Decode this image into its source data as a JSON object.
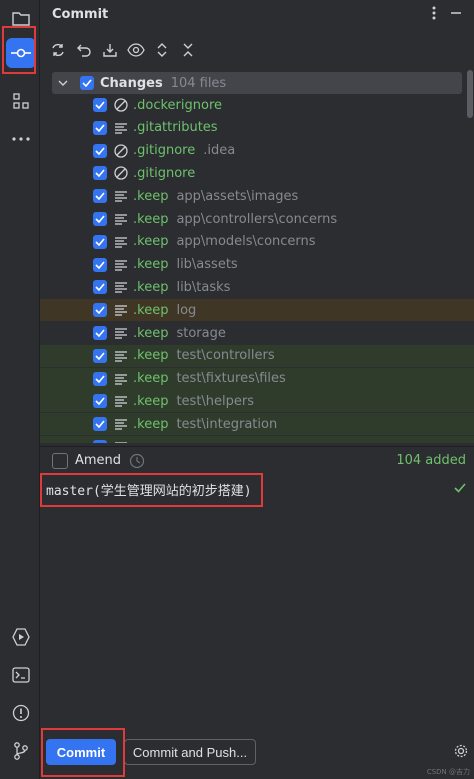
{
  "panel": {
    "title": "Commit"
  },
  "changes": {
    "label": "Changes",
    "count_text": "104 files"
  },
  "files": [
    {
      "name": ".dockerignore",
      "path": "",
      "icon": "ignore-icon",
      "hl": ""
    },
    {
      "name": ".gitattributes",
      "path": "",
      "icon": "text-file-icon",
      "hl": ""
    },
    {
      "name": ".gitignore",
      "path": ".idea",
      "icon": "ignore-icon",
      "hl": ""
    },
    {
      "name": ".gitignore",
      "path": "",
      "icon": "ignore-icon",
      "hl": ""
    },
    {
      "name": ".keep",
      "path": "app\\assets\\images",
      "icon": "text-file-icon",
      "hl": ""
    },
    {
      "name": ".keep",
      "path": "app\\controllers\\concerns",
      "icon": "text-file-icon",
      "hl": ""
    },
    {
      "name": ".keep",
      "path": "app\\models\\concerns",
      "icon": "text-file-icon",
      "hl": ""
    },
    {
      "name": ".keep",
      "path": "lib\\assets",
      "icon": "text-file-icon",
      "hl": ""
    },
    {
      "name": ".keep",
      "path": "lib\\tasks",
      "icon": "text-file-icon",
      "hl": ""
    },
    {
      "name": ".keep",
      "path": "log",
      "icon": "text-file-icon",
      "hl": "orange"
    },
    {
      "name": ".keep",
      "path": "storage",
      "icon": "text-file-icon",
      "hl": ""
    },
    {
      "name": ".keep",
      "path": "test\\controllers",
      "icon": "text-file-icon",
      "hl": "green"
    },
    {
      "name": ".keep",
      "path": "test\\fixtures\\files",
      "icon": "text-file-icon",
      "hl": "green"
    },
    {
      "name": ".keep",
      "path": "test\\helpers",
      "icon": "text-file-icon",
      "hl": "green"
    },
    {
      "name": ".keep",
      "path": "test\\integration",
      "icon": "text-file-icon",
      "hl": "green"
    },
    {
      "name": "",
      "path": "",
      "icon": "text-file-icon",
      "hl": "green"
    }
  ],
  "amend": {
    "label": "Amend",
    "added_text": "104 added"
  },
  "message": {
    "text": "master(学生管理网站的初步搭建)"
  },
  "buttons": {
    "commit": "Commit",
    "commit_push": "Commit and Push..."
  },
  "watermark": "CSDN @吉力",
  "colors": {
    "accent": "#3574f0",
    "added_green": "#6fc16d",
    "annotation_red": "#e03b3b"
  }
}
